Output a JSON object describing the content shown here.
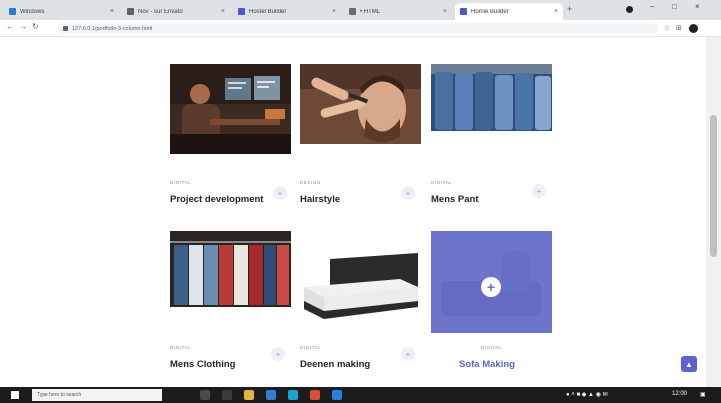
{
  "browser": {
    "tabs": [
      {
        "title": "Windows",
        "color": "#2b7bd6",
        "active": false
      },
      {
        "title": "Nov - sur Envato",
        "color": "#5f6368",
        "active": false
      },
      {
        "title": "Hostel Builder",
        "color": "#4a56d6",
        "active": false
      },
      {
        "title": "• HTML",
        "color": "#6b6b6b",
        "active": false
      },
      {
        "title": "Homie Builder",
        "color": "#4a56d6",
        "active": true
      }
    ],
    "new_tab": "+",
    "url": "127.0.0.1/portfolio-3-column.html",
    "win_min": "–",
    "win_max": "□",
    "win_close": "×"
  },
  "portfolio": [
    {
      "category": "DIGITAL",
      "title": "Project development",
      "button": "+"
    },
    {
      "category": "DESIGN",
      "title": "Hairstyle",
      "button": "+"
    },
    {
      "category": "DIGITAL",
      "title": "Mens Pant",
      "button": "+"
    },
    {
      "category": "DIGITAL",
      "title": "Mens Clothing",
      "button": "+"
    },
    {
      "category": "DIGITAL",
      "title": "Deenen making",
      "button": "+"
    },
    {
      "category": "DIGITAL",
      "title": "Sofa Making",
      "button": "+",
      "hover": true
    }
  ],
  "overlay_plus": "+",
  "back_to_top": "▲",
  "taskbar": {
    "search_placeholder": "Type here to search",
    "clock": "12:00"
  },
  "colors": {
    "accent": "#5b63d3",
    "overlay": "#676ed6",
    "title": "#1f1f2e"
  }
}
